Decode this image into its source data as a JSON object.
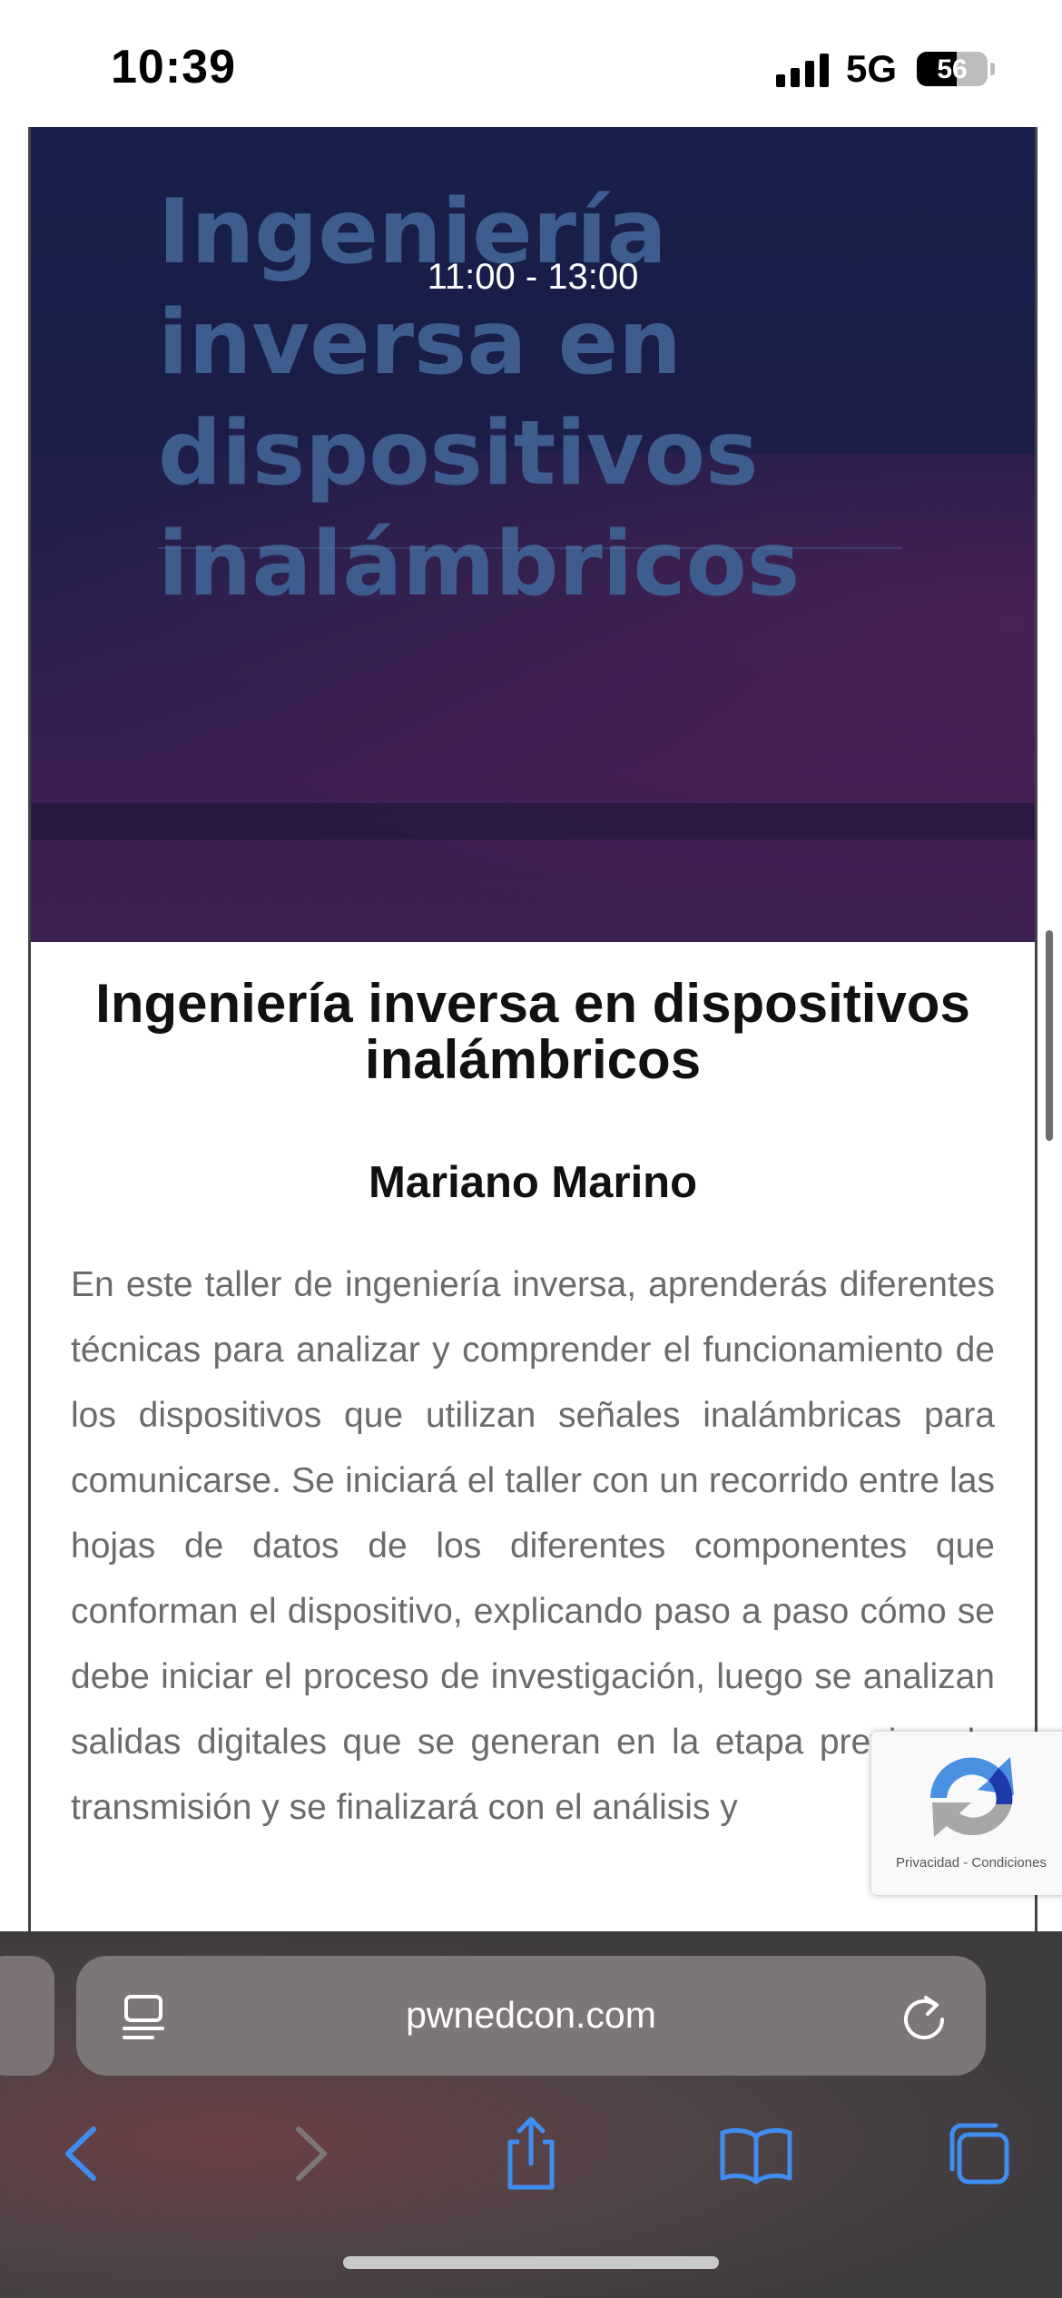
{
  "status_bar": {
    "time": "10:39",
    "network": "5G",
    "battery": "56",
    "battery_level": 0.56
  },
  "banner": {
    "title": "Ingeniería inversa en dispositivos inalámbricos",
    "time": "11:00 - 13:00"
  },
  "talk": {
    "title": "Ingeniería inversa en dispositivos inalámbricos",
    "speaker": "Mariano Marino",
    "description": "En este taller de ingeniería inversa, aprenderás diferentes técnicas para analizar y comprender el funcionamiento de los dispositivos que utilizan señales inalámbricas para comunicarse. Se iniciará el taller con un recorrido entre las hojas de datos de los diferentes componentes que conforman el dispositivo, explicando paso a paso cómo se debe iniciar el proceso de investigación, luego se analizan salidas digitales que se generan en la etapa previa a la transmisión y se finalizará con el análisis y"
  },
  "recaptcha": {
    "privacy": "Privacidad",
    "separator": "-",
    "terms": "Condiciones"
  },
  "safari": {
    "url": "pwnedcon.com"
  },
  "icons": [
    "signal-icon",
    "battery-icon",
    "recaptcha-icon",
    "reader-icon",
    "reload-icon",
    "back-icon",
    "forward-icon",
    "share-icon",
    "bookmarks-icon",
    "tabs-icon"
  ],
  "colors": {
    "accent": "#3f8df0",
    "banner_title": "#3f5c8e",
    "body_text": "#6b6b6b"
  }
}
